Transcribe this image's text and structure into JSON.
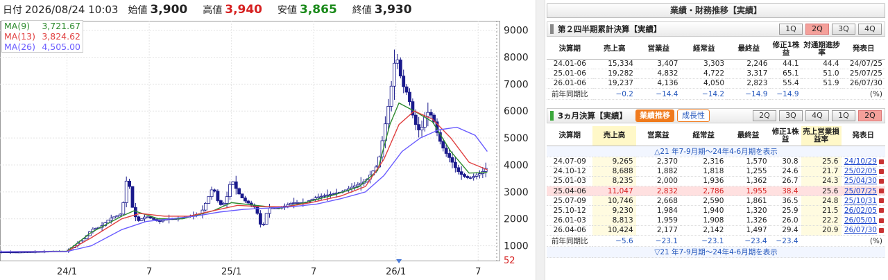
{
  "chart": {
    "header": {
      "date_label": "日付",
      "datetime": "2026/08/24 10:03",
      "open_label": "始値",
      "open": "3,900",
      "high_label": "高値",
      "high": "3,940",
      "low_label": "安値",
      "low": "3,865",
      "close_label": "終値",
      "close": "3,930"
    },
    "ma_legend": [
      {
        "name": "MA(9)",
        "value": "3,721.67",
        "color": "#2e8b2e"
      },
      {
        "name": "MA(13)",
        "value": "3,824.62",
        "color": "#e04040"
      },
      {
        "name": "MA(26)",
        "value": "4,505.00",
        "color": "#6a5cff"
      }
    ],
    "marker_left": "52",
    "colors": {
      "up": "#ffffff",
      "down": "#1a1a8c",
      "bar": "#1a1a8c"
    }
  },
  "chart_data": {
    "type": "line",
    "title": "",
    "x_ticks": [
      "24/1",
      "7",
      "25/1",
      "7",
      "26/1",
      "7"
    ],
    "y_ticks": [
      1000,
      2000,
      3000,
      4000,
      5000,
      6000,
      7000,
      8000,
      9000
    ],
    "ylim": [
      450,
      9350
    ],
    "price": [
      [
        0,
        770
      ],
      [
        6,
        760
      ],
      [
        12,
        780
      ],
      [
        18,
        800
      ],
      [
        22,
        800
      ],
      [
        25,
        1050
      ],
      [
        28,
        1300
      ],
      [
        30,
        1600
      ],
      [
        33,
        1700
      ],
      [
        36,
        2000
      ],
      [
        38,
        2100
      ],
      [
        40,
        2200
      ],
      [
        42,
        3800
      ],
      [
        43,
        2600
      ],
      [
        45,
        1900
      ],
      [
        48,
        2100
      ],
      [
        52,
        1900
      ],
      [
        55,
        2000
      ],
      [
        58,
        2000
      ],
      [
        62,
        2100
      ],
      [
        66,
        2200
      ],
      [
        70,
        3200
      ],
      [
        72,
        2500
      ],
      [
        74,
        2600
      ],
      [
        76,
        3500
      ],
      [
        78,
        3000
      ],
      [
        80,
        2700
      ],
      [
        84,
        2400
      ],
      [
        86,
        1600
      ],
      [
        88,
        2400
      ],
      [
        92,
        2400
      ],
      [
        96,
        2600
      ],
      [
        100,
        2600
      ],
      [
        104,
        2800
      ],
      [
        108,
        2900
      ],
      [
        112,
        3000
      ],
      [
        116,
        3200
      ],
      [
        120,
        3400
      ],
      [
        124,
        4000
      ],
      [
        126,
        5200
      ],
      [
        128,
        6500
      ],
      [
        130,
        8200
      ],
      [
        132,
        7000
      ],
      [
        134,
        6600
      ],
      [
        136,
        5600
      ],
      [
        138,
        5200
      ],
      [
        140,
        6000
      ],
      [
        142,
        5800
      ],
      [
        144,
        5000
      ],
      [
        146,
        4500
      ],
      [
        148,
        4200
      ],
      [
        150,
        3800
      ],
      [
        152,
        3600
      ],
      [
        154,
        3500
      ],
      [
        156,
        3600
      ],
      [
        158,
        3700
      ],
      [
        160,
        3930
      ]
    ],
    "series": [
      {
        "name": "MA(9)",
        "values": [
          [
            0,
            780
          ],
          [
            22,
            800
          ],
          [
            30,
            1500
          ],
          [
            40,
            2100
          ],
          [
            44,
            2300
          ],
          [
            52,
            2000
          ],
          [
            60,
            2000
          ],
          [
            70,
            2300
          ],
          [
            76,
            2600
          ],
          [
            84,
            2500
          ],
          [
            92,
            2400
          ],
          [
            100,
            2600
          ],
          [
            110,
            2900
          ],
          [
            118,
            3200
          ],
          [
            124,
            3800
          ],
          [
            128,
            5500
          ],
          [
            131,
            6300
          ],
          [
            136,
            6000
          ],
          [
            142,
            5600
          ],
          [
            148,
            4500
          ],
          [
            154,
            3700
          ],
          [
            160,
            3720
          ]
        ]
      },
      {
        "name": "MA(13)",
        "values": [
          [
            0,
            780
          ],
          [
            22,
            790
          ],
          [
            30,
            1300
          ],
          [
            40,
            2000
          ],
          [
            46,
            2200
          ],
          [
            54,
            2100
          ],
          [
            62,
            2100
          ],
          [
            70,
            2300
          ],
          [
            78,
            2500
          ],
          [
            86,
            2450
          ],
          [
            94,
            2450
          ],
          [
            102,
            2600
          ],
          [
            112,
            2850
          ],
          [
            120,
            3200
          ],
          [
            126,
            4200
          ],
          [
            131,
            5500
          ],
          [
            136,
            6000
          ],
          [
            142,
            5700
          ],
          [
            148,
            5000
          ],
          [
            154,
            4100
          ],
          [
            160,
            3820
          ]
        ]
      },
      {
        "name": "MA(26)",
        "values": [
          [
            0,
            780
          ],
          [
            22,
            790
          ],
          [
            30,
            1000
          ],
          [
            40,
            1600
          ],
          [
            48,
            1900
          ],
          [
            56,
            2000
          ],
          [
            64,
            2100
          ],
          [
            72,
            2250
          ],
          [
            80,
            2350
          ],
          [
            88,
            2400
          ],
          [
            96,
            2450
          ],
          [
            104,
            2550
          ],
          [
            112,
            2750
          ],
          [
            120,
            3000
          ],
          [
            126,
            3600
          ],
          [
            132,
            4500
          ],
          [
            138,
            5000
          ],
          [
            144,
            5300
          ],
          [
            150,
            5400
          ],
          [
            156,
            5100
          ],
          [
            160,
            4500
          ]
        ]
      }
    ]
  },
  "fin": {
    "title": "業績・財務推移【実績】",
    "s1": {
      "title": "第２四半期累計決算【実績】",
      "tabs": [
        "1Q",
        "2Q",
        "3Q",
        "4Q"
      ],
      "headers": [
        "決算期",
        "売上高",
        "営業益",
        "経常益",
        "最終益",
        "修正1株益",
        "対通期進捗率",
        "発表日"
      ],
      "rows": [
        [
          "24.01-06",
          "15,334",
          "3,407",
          "3,303",
          "2,246",
          "44.1",
          "44.4",
          "24/07/25"
        ],
        [
          "25.01-06",
          "19,282",
          "4,832",
          "4,722",
          "3,317",
          "65.1",
          "51.0",
          "25/07/25"
        ],
        [
          "26.01-06",
          "19,237",
          "4,136",
          "4,050",
          "2,823",
          "55.4",
          "51.9",
          "26/07/30"
        ]
      ],
      "yoy": [
        "前年同期比",
        "−0.2",
        "−14.4",
        "−14.2",
        "−14.9",
        "−14.9",
        "",
        "(%)"
      ]
    },
    "s2": {
      "title": "3ヵ月決算【実績】",
      "pill_on": "業績推移",
      "pill_off": "成長性",
      "tabs": [
        "2Q",
        "3Q",
        "4Q",
        "1Q",
        "2Q"
      ],
      "headers": [
        "決算期",
        "売上高",
        "営業益",
        "経常益",
        "最終益",
        "修正1株益",
        "売上営業損益率",
        "発表日"
      ],
      "range_top": "△21 年7-9月期～24年4-6月期を表示",
      "rows": [
        [
          "24.07-09",
          "9,265",
          "2,370",
          "2,316",
          "1,570",
          "30.8",
          "25.6",
          "24/10/29"
        ],
        [
          "24.10-12",
          "8,688",
          "1,882",
          "1,818",
          "1,255",
          "24.6",
          "21.7",
          "25/02/05"
        ],
        [
          "25.01-03",
          "8,235",
          "2,000",
          "1,936",
          "1,362",
          "26.7",
          "24.3",
          "25/04/30"
        ],
        [
          "25.04-06",
          "11,047",
          "2,832",
          "2,786",
          "1,955",
          "38.4",
          "25.6",
          "25/07/25"
        ],
        [
          "25.07-09",
          "10,746",
          "2,668",
          "2,590",
          "1,861",
          "36.5",
          "24.8",
          "25/10/31"
        ],
        [
          "25.10-12",
          "9,230",
          "1,984",
          "1,940",
          "1,320",
          "25.9",
          "21.5",
          "26/02/05"
        ],
        [
          "26.01-03",
          "8,813",
          "1,959",
          "1,908",
          "1,326",
          "26.0",
          "22.2",
          "26/05/01"
        ],
        [
          "26.04-06",
          "10,424",
          "2,177",
          "2,142",
          "1,497",
          "29.4",
          "20.9",
          "26/07/30"
        ]
      ],
      "yoy": [
        "前年同期比",
        "−5.6",
        "−23.1",
        "−23.1",
        "−23.4",
        "−23.4",
        "",
        "(%)"
      ],
      "range_bottom": "▽21 年7-9月期～24年4-6月期を表示"
    }
  }
}
